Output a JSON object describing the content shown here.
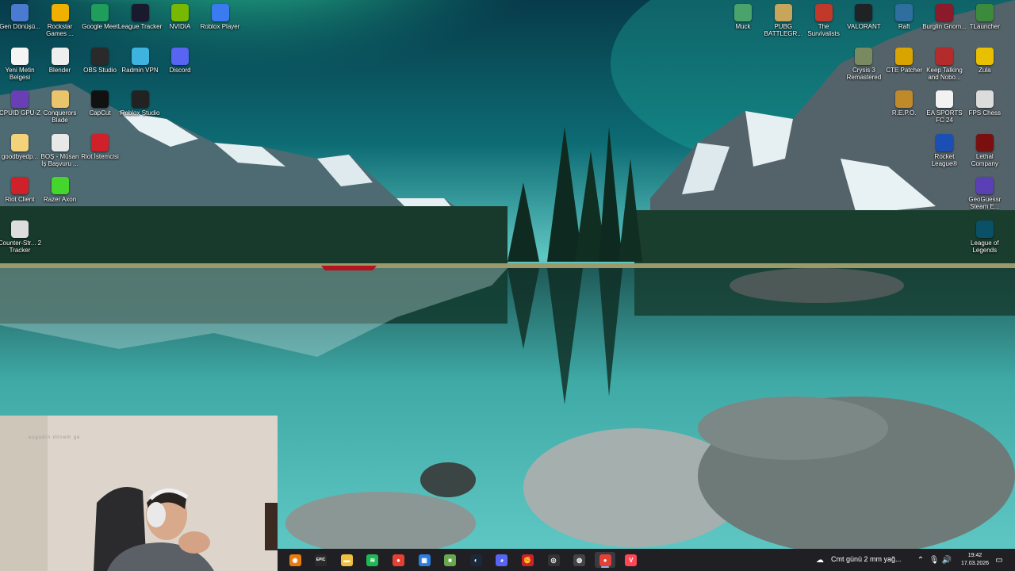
{
  "desktop_icons_left": [
    {
      "label": "Gen Dönüşü...",
      "icon": "settings-app-icon",
      "color": "#4a7bd0"
    },
    {
      "label": "Rockstar Games ...",
      "icon": "rockstar-icon",
      "color": "#f0b000"
    },
    {
      "label": "Google Meet",
      "icon": "google-meet-icon",
      "color": "#1e9e5a"
    },
    {
      "label": "League Tracker",
      "icon": "league-tracker-icon",
      "color": "#1a1a2e"
    },
    {
      "label": "NVIDIA",
      "icon": "nvidia-icon",
      "color": "#76b900"
    },
    {
      "label": "Roblox Player",
      "icon": "roblox-icon",
      "color": "#3b7bf0"
    },
    {
      "label": "Yeni Metin Belgesi",
      "icon": "text-document-icon",
      "color": "#f5f5f5"
    },
    {
      "label": "Blender",
      "icon": "blender-icon",
      "color": "#eeeeee"
    },
    {
      "label": "OBS Studio",
      "icon": "obs-icon",
      "color": "#2a2a2a"
    },
    {
      "label": "Radmin VPN",
      "icon": "radmin-vpn-icon",
      "color": "#3fb3e0"
    },
    {
      "label": "Discord",
      "icon": "discord-icon",
      "color": "#5865f2"
    },
    {
      "label": "CPUID GPU-Z",
      "icon": "gpuz-icon",
      "color": "#6a3fb5"
    },
    {
      "label": "Conquerors Blade",
      "icon": "folder-icon",
      "color": "#e9c46a"
    },
    {
      "label": "CapCut",
      "icon": "capcut-icon",
      "color": "#111111"
    },
    {
      "label": "Roblox Studio",
      "icon": "roblox-studio-icon",
      "color": "#222222"
    },
    {
      "label": "goodbyedp...",
      "icon": "file-icon",
      "color": "#f3d27a"
    },
    {
      "label": "BOŞ - Müsan İş Başvuru ...",
      "icon": "excel-file-icon",
      "color": "#e8e8e8"
    },
    {
      "label": "Riot İstemcisi",
      "icon": "riot-icon",
      "color": "#d0202a"
    },
    {
      "label": "Riot Client",
      "icon": "riot-client-icon",
      "color": "#d0202a"
    },
    {
      "label": "Razer Axon",
      "icon": "razer-icon",
      "color": "#44d62c"
    },
    {
      "label": "Counter-Str... 2 Tracker",
      "icon": "cs2-tracker-icon",
      "color": "#dddddd"
    }
  ],
  "desktop_icons_right": [
    {
      "label": "Muck",
      "icon": "muck-icon",
      "color": "#4aa36a"
    },
    {
      "label": "PUBG BATTLEGR...",
      "icon": "pubg-icon",
      "color": "#c7a55a"
    },
    {
      "label": "The Survivalists",
      "icon": "survivalists-icon",
      "color": "#c0392b"
    },
    {
      "label": "VALORANT",
      "icon": "valorant-icon",
      "color": "#1f2326"
    },
    {
      "label": "Raft",
      "icon": "raft-icon",
      "color": "#2f6f9f"
    },
    {
      "label": "Burglin Gnom...",
      "icon": "burglin-gnomes-icon",
      "color": "#8b1a2b"
    },
    {
      "label": "TLauncher",
      "icon": "tlauncher-icon",
      "color": "#3c8b3c"
    },
    {
      "label": "Crysis 3 Remastered",
      "icon": "crysis-icon",
      "color": "#7a8a60"
    },
    {
      "label": "CTE Patcher",
      "icon": "cte-patcher-icon",
      "color": "#d9a400"
    },
    {
      "label": "Keep Talking and Nobo...",
      "icon": "keep-talking-icon",
      "color": "#b32b2b"
    },
    {
      "label": "Zula",
      "icon": "zula-icon",
      "color": "#e8c000"
    },
    {
      "label": "R.E.P.O.",
      "icon": "repo-icon",
      "color": "#c08a2a"
    },
    {
      "label": "EA SPORTS FC 24",
      "icon": "ea-fc-icon",
      "color": "#f2f2f2"
    },
    {
      "label": "FPS Chess",
      "icon": "fps-chess-icon",
      "color": "#dcdcdc"
    },
    {
      "label": "Rocket League®",
      "icon": "rocket-league-icon",
      "color": "#1b4fb3"
    },
    {
      "label": "Lethal Company",
      "icon": "lethal-company-icon",
      "color": "#7a0f0f"
    },
    {
      "label": "GeoGuessr Steam E...",
      "icon": "geoguessr-icon",
      "color": "#5b3fb5"
    },
    {
      "label": "League of Legends",
      "icon": "league-of-legends-icon",
      "color": "#0a5066"
    }
  ],
  "webcam": {
    "caption": "eşgadin dönem ge"
  },
  "taskbar": {
    "apps": [
      {
        "name": "blender-taskbar-icon",
        "glyph": "◉",
        "color": "#e87d0d"
      },
      {
        "name": "epic-games-taskbar-icon",
        "glyph": "EPIC",
        "color": "#2a2a2a"
      },
      {
        "name": "file-explorer-taskbar-icon",
        "glyph": "▬",
        "color": "#f0c040"
      },
      {
        "name": "spotify-taskbar-icon",
        "glyph": "≋",
        "color": "#1db954"
      },
      {
        "name": "chrome-taskbar-icon",
        "glyph": "●",
        "color": "#e34133"
      },
      {
        "name": "store-taskbar-icon",
        "glyph": "▦",
        "color": "#2b7de0"
      },
      {
        "name": "minecraft-taskbar-icon",
        "glyph": "■",
        "color": "#6aa84f"
      },
      {
        "name": "steam-taskbar-icon",
        "glyph": "◐",
        "color": "#1b2838"
      },
      {
        "name": "discord-taskbar-icon",
        "glyph": "◕",
        "color": "#5865f2"
      },
      {
        "name": "riot-taskbar-icon",
        "glyph": "✊",
        "color": "#d0202a"
      },
      {
        "name": "obs-taskbar-icon",
        "glyph": "◎",
        "color": "#333333"
      },
      {
        "name": "github-taskbar-icon",
        "glyph": "◍",
        "color": "#444444"
      },
      {
        "name": "chrome-active-taskbar-icon",
        "glyph": "●",
        "color": "#e34133"
      },
      {
        "name": "valorant-taskbar-icon",
        "glyph": "V",
        "color": "#ff4655"
      }
    ],
    "weather": "Cmt günü 2 mm yağ...",
    "clock_time": "19:42",
    "clock_date": "17.03.2026"
  }
}
